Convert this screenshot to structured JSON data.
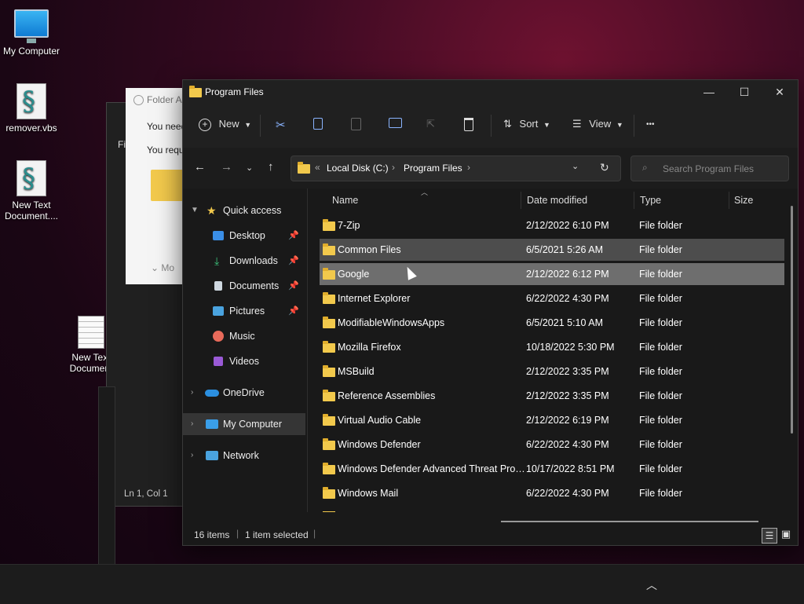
{
  "desktop": {
    "icons": [
      {
        "label": "My Computer",
        "icon": "monitor-icon"
      },
      {
        "label": "remover.vbs",
        "icon": "script-file-icon"
      },
      {
        "label": "New Text Document....",
        "icon": "script-file-icon"
      },
      {
        "label": "New Text Document",
        "icon": "text-file-icon"
      }
    ]
  },
  "background_windows": {
    "folder_access_title": "Folder A",
    "line1": "You need",
    "line2": "You requ",
    "more": "Mo",
    "notepad_status": "Ln 1, Col 1",
    "notepad_menu": "Fi"
  },
  "explorer": {
    "title": "Program Files",
    "window_controls": {
      "minimize": "—",
      "maximize": "☐",
      "close": "✕"
    },
    "toolbar": {
      "new_label": "New",
      "sort_label": "Sort",
      "view_label": "View",
      "more_label": "•••"
    },
    "address": {
      "overflow": "«",
      "crumbs": [
        "Local Disk (C:)",
        "Program Files"
      ],
      "search_placeholder": "Search Program Files"
    },
    "sidebar": {
      "quick_access": "Quick access",
      "quick_items": [
        {
          "label": "Desktop",
          "pinned": true
        },
        {
          "label": "Downloads",
          "pinned": true
        },
        {
          "label": "Documents",
          "pinned": true
        },
        {
          "label": "Pictures",
          "pinned": true
        },
        {
          "label": "Music",
          "pinned": false
        },
        {
          "label": "Videos",
          "pinned": false
        }
      ],
      "onedrive": "OneDrive",
      "my_computer": "My Computer",
      "network": "Network"
    },
    "columns": {
      "name": "Name",
      "date": "Date modified",
      "type": "Type",
      "size": "Size"
    },
    "rows": [
      {
        "name": "7-Zip",
        "date": "2/12/2022 6:10 PM",
        "type": "File folder"
      },
      {
        "name": "Common Files",
        "date": "6/5/2021 5:26 AM",
        "type": "File folder"
      },
      {
        "name": "Google",
        "date": "2/12/2022 6:12 PM",
        "type": "File folder"
      },
      {
        "name": "Internet Explorer",
        "date": "6/22/2022 4:30 PM",
        "type": "File folder"
      },
      {
        "name": "ModifiableWindowsApps",
        "date": "6/5/2021 5:10 AM",
        "type": "File folder"
      },
      {
        "name": "Mozilla Firefox",
        "date": "10/18/2022 5:30 PM",
        "type": "File folder"
      },
      {
        "name": "MSBuild",
        "date": "2/12/2022 3:35 PM",
        "type": "File folder"
      },
      {
        "name": "Reference Assemblies",
        "date": "2/12/2022 3:35 PM",
        "type": "File folder"
      },
      {
        "name": "Virtual Audio Cable",
        "date": "2/12/2022 6:19 PM",
        "type": "File folder"
      },
      {
        "name": "Windows Defender",
        "date": "6/22/2022 4:30 PM",
        "type": "File folder"
      },
      {
        "name": "Windows Defender Advanced Threat Prot...",
        "date": "10/17/2022 8:51 PM",
        "type": "File folder"
      },
      {
        "name": "Windows Mail",
        "date": "6/22/2022 4:30 PM",
        "type": "File folder"
      }
    ],
    "status": {
      "count": "16 items",
      "selected": "1 item selected"
    }
  },
  "taskbar": {
    "tray_chevron": "︿"
  }
}
